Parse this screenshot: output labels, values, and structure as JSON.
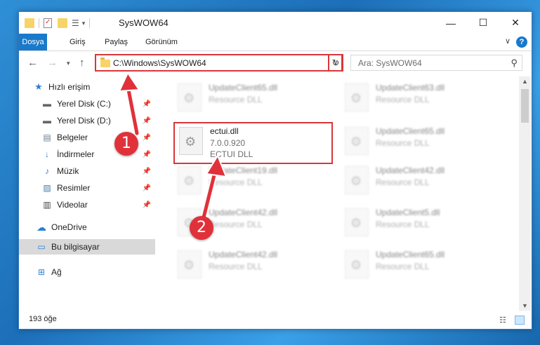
{
  "window": {
    "title": "SysWOW64",
    "controls": {
      "minimize": "—",
      "maximize": "☐",
      "close": "✕"
    }
  },
  "ribbon": {
    "tabs": [
      {
        "label": "Dosya",
        "active": true
      },
      {
        "label": "Giriş",
        "active": false
      },
      {
        "label": "Paylaş",
        "active": false
      },
      {
        "label": "Görünüm",
        "active": false
      }
    ]
  },
  "nav": {
    "address": "C:\\Windows\\SysWOW64",
    "search_placeholder": "Ara: SysWOW64"
  },
  "sidebar": {
    "quick_access": "Hızlı erişim",
    "items": [
      {
        "label": "Yerel Disk (C:)",
        "icon": "drive-icon"
      },
      {
        "label": "Yerel Disk (D:)",
        "icon": "drive-icon"
      },
      {
        "label": "Belgeler",
        "icon": "documents-icon"
      },
      {
        "label": "İndirmeler",
        "icon": "download-icon"
      },
      {
        "label": "Müzik",
        "icon": "music-icon"
      },
      {
        "label": "Resimler",
        "icon": "pictures-icon"
      },
      {
        "label": "Videolar",
        "icon": "videos-icon"
      }
    ],
    "onedrive": "OneDrive",
    "this_pc": "Bu bilgisayar",
    "network": "Ağ"
  },
  "files": {
    "left": [
      {
        "name": "UpdateClient65.dll",
        "type": "Resource DLL"
      },
      {
        "name": "ectui.dll",
        "version": "7.0.0.920",
        "type": "ECTUI DLL"
      },
      {
        "name": "UpdateClient19.dll",
        "type": "Resource DLL"
      },
      {
        "name": "UpdateClient42.dll",
        "type": "Resource DLL"
      },
      {
        "name": "UpdateClient42.dll",
        "type": "Resource DLL"
      }
    ],
    "right": [
      {
        "name": "UpdateClient63.dll",
        "type": "Resource DLL"
      },
      {
        "name": "UpdateClient65.dll",
        "type": "Resource DLL"
      },
      {
        "name": "UpdateClient42.dll",
        "type": "Resource DLL"
      },
      {
        "name": "UpdateClient5.dll",
        "type": "Resource DLL"
      },
      {
        "name": "UpdateClient65.dll",
        "type": "Resource DLL"
      }
    ]
  },
  "status": {
    "count": "193 öğe"
  },
  "callouts": {
    "one": "1",
    "two": "2"
  },
  "colors": {
    "accent": "#1979ca",
    "highlight": "#d9363a",
    "callout": "#e0313a"
  }
}
